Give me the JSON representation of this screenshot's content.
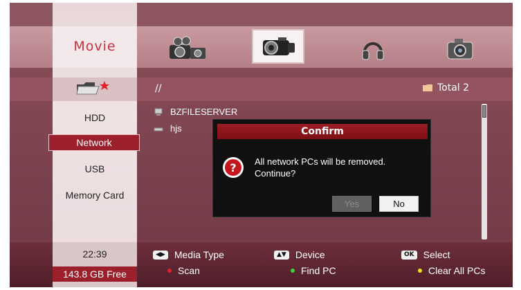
{
  "media_tabs": {
    "active_label": "Movie",
    "icons": [
      "photo-camera-film-icon",
      "video-camera-icon",
      "headphones-icon",
      "digital-camera-icon"
    ]
  },
  "path": {
    "current": "//",
    "total_label": "Total 2"
  },
  "devices": {
    "items": [
      "HDD",
      "Network",
      "USB",
      "Memory Card"
    ],
    "selected": "Network"
  },
  "files": [
    {
      "name": "BZFILESERVER",
      "icon": "server-icon"
    },
    {
      "name": "hjs",
      "icon": "pc-icon"
    }
  ],
  "dialog": {
    "title": "Confirm",
    "message_line1": "All network PCs will be removed.",
    "message_line2": "Continue?",
    "yes_label": "Yes",
    "no_label": "No",
    "icon": "question-icon"
  },
  "status": {
    "time": "22:39",
    "free_space": "143.8 GB Free"
  },
  "hints": {
    "media_type": {
      "key": "◀▶",
      "label": "Media Type"
    },
    "device": {
      "key": "▲▼",
      "label": "Device"
    },
    "select": {
      "key": "OK",
      "label": "Select"
    },
    "scan": {
      "color": "#e0202a",
      "label": "Scan"
    },
    "find_pc": {
      "color": "#3cd23c",
      "label": "Find PC"
    },
    "clear_all": {
      "color": "#f2e21c",
      "label": "Clear All PCs"
    }
  }
}
